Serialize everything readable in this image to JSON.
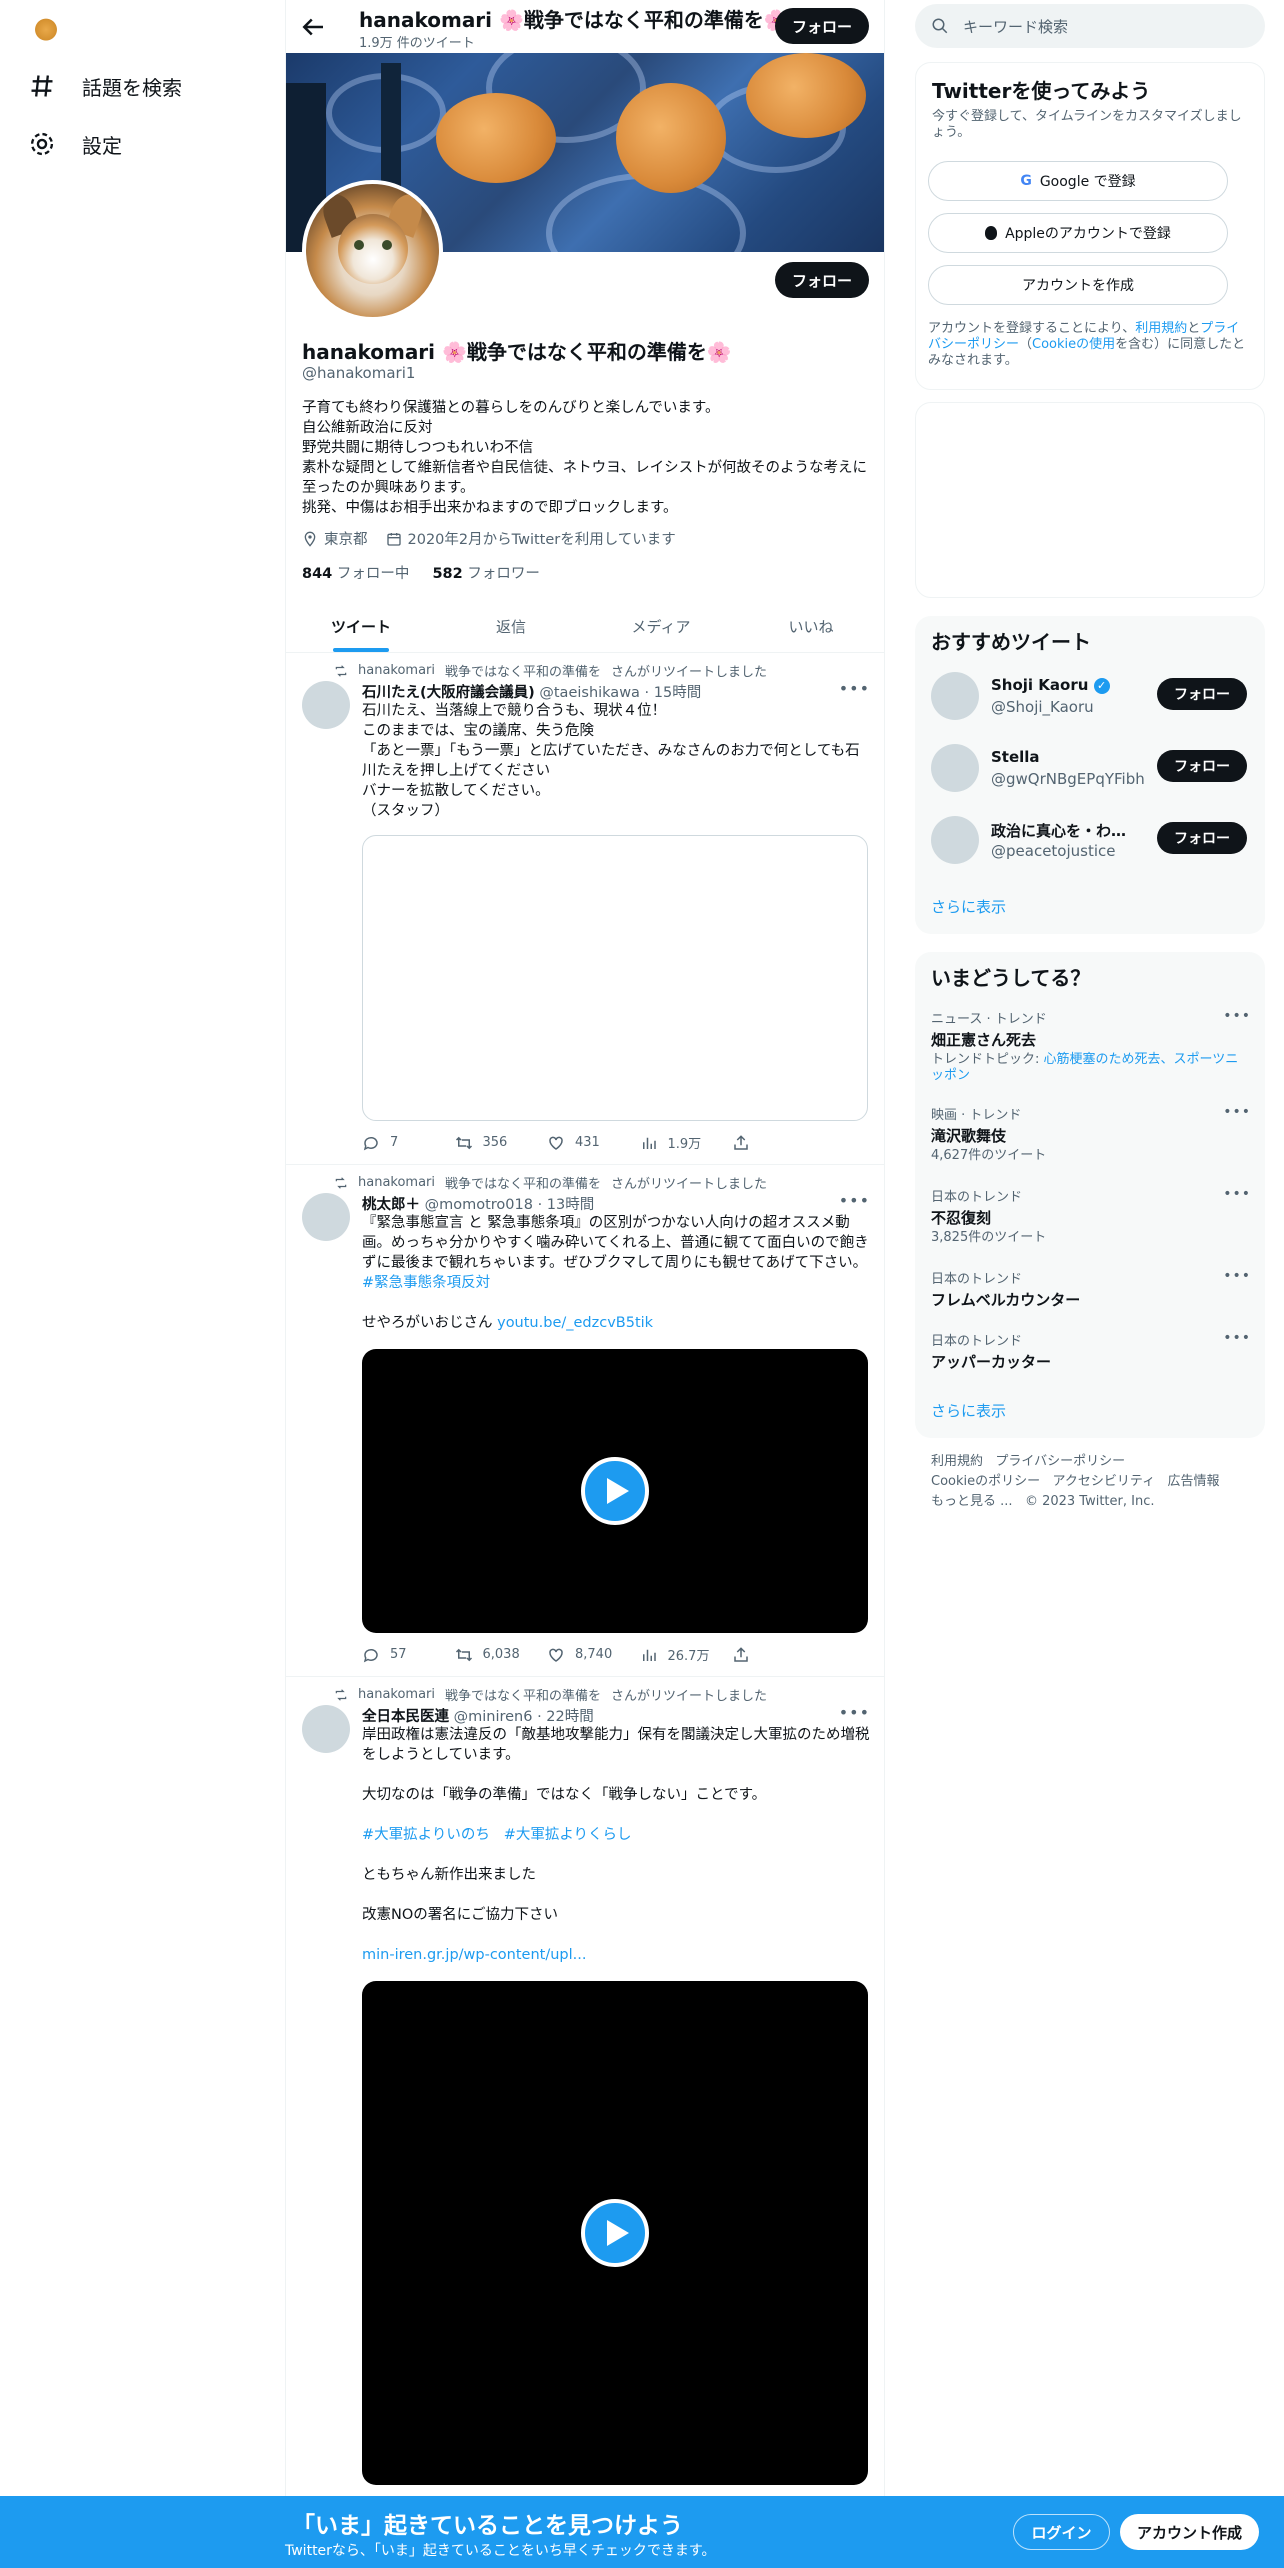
{
  "leftnav": {
    "explore_label": "話題を検索",
    "settings_label": "設定"
  },
  "header": {
    "name": "hanakomari 🌸戦争ではなく平和の準備を🌸",
    "tweet_count": "1.9万 件のツイート",
    "follow_label": "フォロー"
  },
  "profile": {
    "name": "hanakomari 🌸戦争ではなく平和の準備を🌸",
    "handle": "@hanakomari1",
    "follow_label": "フォロー",
    "bio_lines": [
      "子育ても終わり保護猫との暮らしをのんびりと楽しんでいます。",
      "自公維新政治に反対",
      "野党共闘に期待しつつもれいわ不信",
      "素朴な疑問として維新信者や自民信徒、ネトウヨ、レイシストが何故そのような考えに至ったのか興味あります。",
      "挑発、中傷はお相手出来かねますので即ブロックします。"
    ],
    "location": "東京都",
    "joined": "2020年2月からTwitterを利用しています",
    "following_count": "844",
    "following_label": "フォロー中",
    "followers_count": "582",
    "followers_label": "フォロワー"
  },
  "tabs": [
    "ツイート",
    "返信",
    "メディア",
    "いいね"
  ],
  "tweets": [
    {
      "retweet_by": "hanakomari",
      "retweet_name": "戦争ではなく平和の準備を",
      "retweet_suffix": "さんがリツイートしました",
      "author": "石川たえ(大阪府議会議員)",
      "handle_time": "@taeishikawa · 15時間",
      "lines": [
        "石川たえ、当落線上で競り合うも、現状４位！",
        "このままでは、宝の議席、失う危険",
        "「あと一票」「もう一票」と広げていただき、みなさんのお力で何としても石川たえを押し上げてください",
        "バナーを拡散してください。",
        "（スタッフ）"
      ],
      "replies": "7",
      "retweets": "356",
      "likes": "431",
      "views": "1.9万"
    },
    {
      "retweet_by": "hanakomari",
      "retweet_name": "戦争ではなく平和の準備を",
      "retweet_suffix": "さんがリツイートしました",
      "author": "桃太郎＋",
      "handle_time": "@momotro018 · 13時間",
      "body": "『緊急事態宣言 と 緊急事態条項』の区別がつかない人向けの超オススメ動画。めっちゃ分かりやすく噛み砕いてくれる上、普通に観てて面白いので飽きずに最後まで観れちゃいます。ぜひブクマして周りにも観せてあげて下さい。",
      "hashtag": "#緊急事態条項反対",
      "link_prefix": "せやろがいおじさん",
      "link": "youtu.be/_edzcvB5tik",
      "replies": "57",
      "retweets": "6,038",
      "likes": "8,740",
      "views": "26.7万"
    },
    {
      "retweet_by": "hanakomari",
      "retweet_name": "戦争ではなく平和の準備を",
      "retweet_suffix": "さんがリツイートしました",
      "author": "全日本民医連",
      "handle_time": "@miniren6 · 22時間",
      "p1": "岸田政権は憲法違反の「敵基地攻撃能力」保有を閣議決定し大軍拡のため増税をしようとしています。",
      "p2": "大切なのは「戦争の準備」ではなく「戦争しない」ことです。",
      "hashtag1": "#大軍拡よりいのち",
      "hashtag2": "#大軍拡よりくらし",
      "p3": "ともちゃん新作出来ました",
      "p4": "改憲NOの署名にご協力下さい",
      "link": "min-iren.gr.jp/wp-content/upl..."
    }
  ],
  "right": {
    "search_placeholder": "キーワード検索",
    "signup": {
      "title": "Twitterを使ってみよう",
      "subtitle": "今すぐ登録して、タイムラインをカスタマイズしましょう。",
      "google": "Google で登録",
      "apple": "Appleのアカウントで登録",
      "create": "アカウントを作成",
      "terms_1": "アカウントを登録することにより、",
      "terms_link1": "利用規約",
      "terms_2": "と",
      "terms_link2": "プライバシーポリシー",
      "terms_3": "（",
      "terms_link3": "Cookieの使用",
      "terms_4": "を含む）に同意したとみなされます。"
    },
    "who_to_follow": {
      "title": "おすすめツイート",
      "users": [
        {
          "name": "Shoji Kaoru",
          "handle": "@Shoji_Kaoru",
          "verified": true
        },
        {
          "name": "Stella",
          "handle": "@gwQrNBgEPqYFibh",
          "verified": false
        },
        {
          "name": "政治に真心を・わきまえない...",
          "handle": "@peacetojustice",
          "verified": false
        }
      ],
      "follow_label": "フォロー",
      "more": "さらに表示"
    },
    "trends": {
      "title": "いまどうしてる？",
      "items": [
        {
          "category": "ニュース · トレンド",
          "title": "畑正憲さん死去",
          "extra_prefix": "トレンドトピック: ",
          "extra_link": "心筋梗塞のため死去、スポーツニッポン"
        },
        {
          "category": "映画 · トレンド",
          "title": "滝沢歌舞伎",
          "count": "4,627件のツイート"
        },
        {
          "category": "日本のトレンド",
          "title": "不忍復刻",
          "count": "3,825件のツイート"
        },
        {
          "category": "日本のトレンド",
          "title": "フレムベルカウンター"
        },
        {
          "category": "日本のトレンド",
          "title": "アッパーカッター"
        }
      ],
      "more": "さらに表示"
    },
    "footer": {
      "terms": "利用規約",
      "privacy": "プライバシーポリシー",
      "cookie": "Cookieのポリシー",
      "accessibility": "アクセシビリティ",
      "ads": "広告情報",
      "more": "もっと見る ...",
      "copyright": "© 2023 Twitter, Inc."
    }
  },
  "bottombar": {
    "title": "「いま」起きていることを見つけよう",
    "subtitle": "Twitterなら、「いま」起きていることをいち早くチェックできます。",
    "login": "ログイン",
    "signup": "アカウント作成"
  },
  "colors": {
    "accent": "#1d9bf0",
    "text": "#0f1419",
    "muted": "#536471"
  }
}
